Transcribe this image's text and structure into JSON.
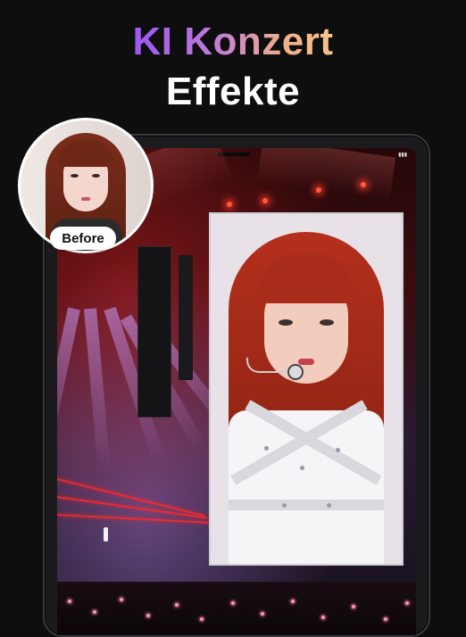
{
  "headline": {
    "line1": "KI Konzert",
    "line2": "Effekte"
  },
  "before_label": "Before",
  "icons": [
    "tablet-frame",
    "before-photo",
    "after-photo"
  ],
  "colors": {
    "background": "#0e0e0f",
    "headline_gradient_start": "#9b57f2",
    "headline_gradient_end": "#f7c38b",
    "headline_line2": "#ffffff"
  }
}
